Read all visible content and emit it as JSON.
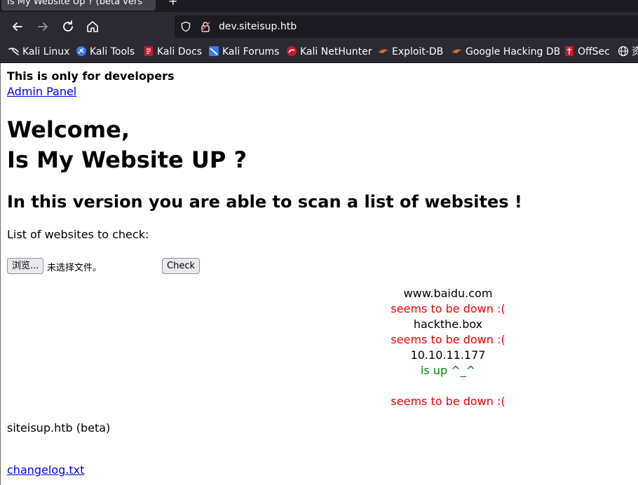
{
  "browser": {
    "tab_title": "Is My Website Up ? (beta vers",
    "url": "dev.siteisup.htb",
    "bookmarks": [
      {
        "label": "Kali Linux",
        "icon": "kali-dragon-icon"
      },
      {
        "label": "Kali Tools",
        "icon": "kali-tools-icon"
      },
      {
        "label": "Kali Docs",
        "icon": "kali-docs-icon"
      },
      {
        "label": "Kali Forums",
        "icon": "kali-forums-icon"
      },
      {
        "label": "Kali NetHunter",
        "icon": "kali-nethunter-icon"
      },
      {
        "label": "Exploit-DB",
        "icon": "exploit-db-icon"
      },
      {
        "label": "Google Hacking DB",
        "icon": "ghdb-icon"
      },
      {
        "label": "OffSec",
        "icon": "offsec-icon"
      },
      {
        "label": "资",
        "icon": "globe-icon"
      }
    ]
  },
  "page": {
    "dev_note": "This is only for developers",
    "admin_link": "Admin Panel",
    "welcome": "Welcome,",
    "title": "Is My Website UP ?",
    "subtitle": "In this version you are able to scan a list of websites !",
    "list_label": "List of websites to check:",
    "browse_button": "浏览...",
    "file_status": "未选择文件。",
    "check_button": "Check",
    "results": [
      {
        "site": "www.baidu.com",
        "status": "seems to be down :(",
        "state": "down"
      },
      {
        "site": "hackthe.box",
        "status": "seems to be down :(",
        "state": "down"
      },
      {
        "site": "10.10.11.177",
        "status": "is up ^_^",
        "state": "up"
      },
      {
        "site": "",
        "status": "seems to be down :(",
        "state": "down"
      }
    ],
    "footer_title": "siteisup.htb (beta)",
    "changelog_link": "changelog.txt"
  },
  "colors": {
    "down": "#ee0000",
    "up": "#008000",
    "link": "#0000ee",
    "toolbar": "#2b2a33"
  }
}
